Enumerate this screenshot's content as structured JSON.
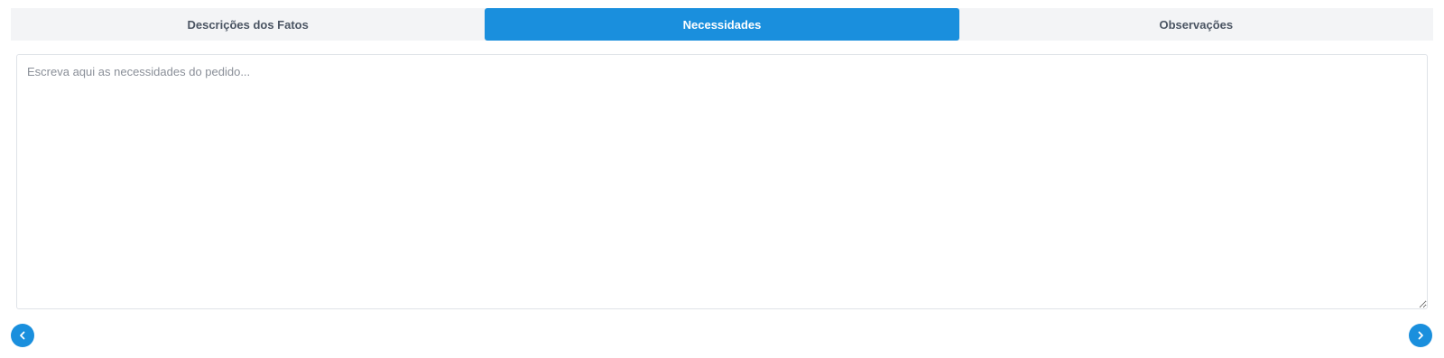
{
  "tabs": [
    {
      "label": "Descrições dos Fatos",
      "active": false
    },
    {
      "label": "Necessidades",
      "active": true
    },
    {
      "label": "Observações",
      "active": false
    }
  ],
  "editor": {
    "value": "",
    "placeholder": "Escreva aqui as necessidades do pedido..."
  },
  "navigation": {
    "prev_icon": "chevron-left-icon",
    "next_icon": "chevron-right-icon"
  },
  "colors": {
    "accent": "#1a8fdd",
    "tab_bar_bg": "#f3f4f6",
    "tab_text": "#4b5563",
    "placeholder": "#8a8f98"
  }
}
